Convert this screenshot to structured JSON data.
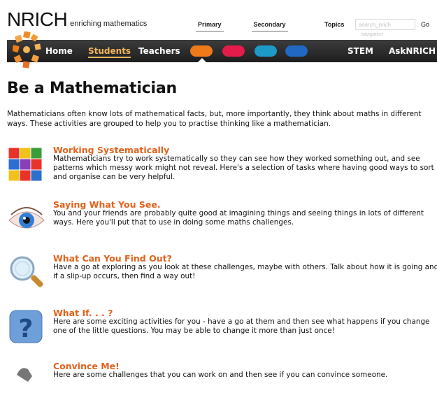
{
  "header": {
    "brand": "NRICH",
    "tagline": "enriching mathematics",
    "stage_tabs": [
      "Primary",
      "Secondary"
    ],
    "topics_label": "Topics",
    "search_placeholder": "search_nrich",
    "search_sub_placeholder": "navigation",
    "go_label": "Go"
  },
  "nav": {
    "home": "Home",
    "students": "Students",
    "teachers": "Teachers",
    "stem": "STEM",
    "ask": "AskNRICH",
    "active": "Students",
    "pill_colors": [
      "#ee7a1a",
      "#e31c4b",
      "#1c9bc8",
      "#2168c2"
    ]
  },
  "main": {
    "title": "Be a Mathematician",
    "intro": "Mathematicians often know lots of mathematical facts, but, more importantly, they think about maths in different ways. These activities are grouped to help you to practise thinking like a mathematician.",
    "activities": [
      {
        "title": "Working Systematically",
        "desc": "Mathematicians try to work systematically so they can see how they worked something out, and see patterns which messy work might not reveal. Here's a selection of tasks where having good ways to sort and organise can be very helpful.",
        "icon": "blocks-grid-icon"
      },
      {
        "title": "Saying What You See.",
        "desc": "You and your friends are probably quite good at imagining things and seeing things in lots of different ways. Here you'll put that to use in doing some maths challenges.",
        "icon": "eye-icon"
      },
      {
        "title": "What Can You Find Out?",
        "desc": "Have a go at exploring as you look at these challenges, maybe with others. Talk about how it is going and if a slip-up occurs, then find a way out!",
        "icon": "magnifier-icon"
      },
      {
        "title": "What If. . . ?",
        "desc": "Here are some exciting activities for you - have a go at them and then see what happens if you change one of the little questions. You may be able to change it more than just once!",
        "icon": "question-mark-icon"
      },
      {
        "title": "Convince Me!",
        "desc": "Here are some challenges that you can work on and then see if you can convince someone.",
        "icon": "hand-icon"
      }
    ]
  },
  "colors": {
    "accent_orange": "#e2621c",
    "nav_bg": "#2a2a2a",
    "nav_active": "#f2b65a"
  }
}
